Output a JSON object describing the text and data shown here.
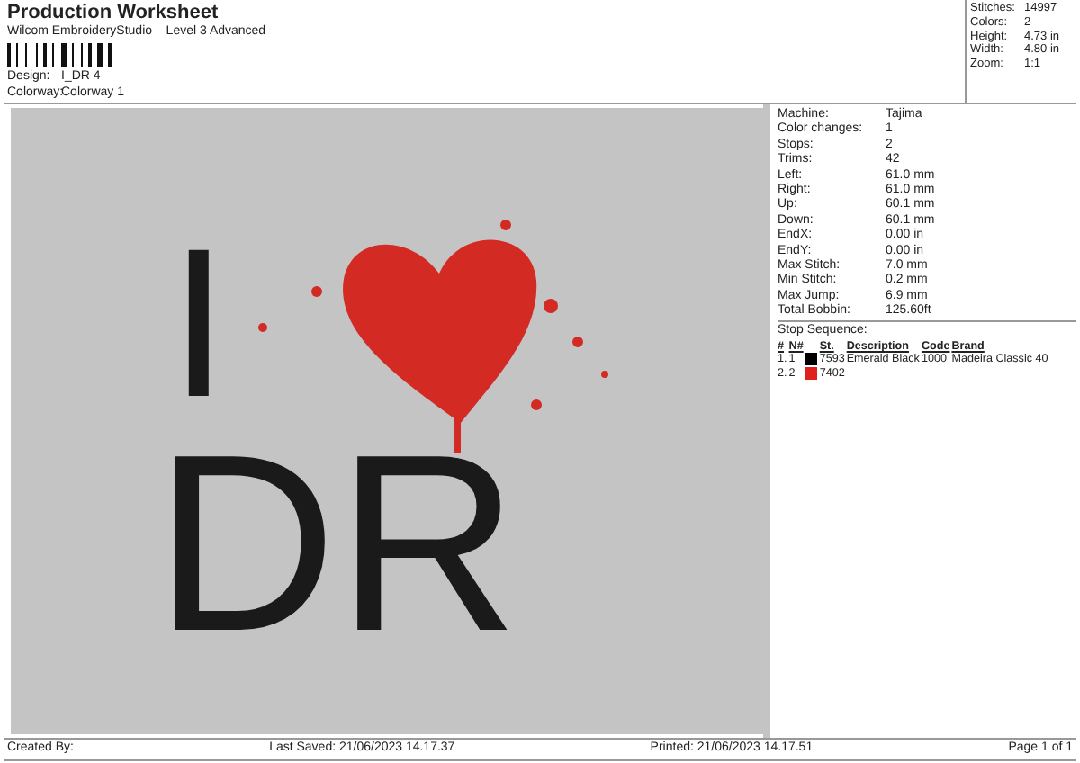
{
  "header": {
    "title": "Production Worksheet",
    "subtitle": "Wilcom EmbroideryStudio – Level 3 Advanced",
    "fields": [
      {
        "label": "Design:",
        "value": "I_DR 4"
      },
      {
        "label": "Colorway:",
        "value": "Colorway 1"
      }
    ]
  },
  "summary": [
    {
      "label": "Stitches:",
      "value": "14997"
    },
    {
      "label": "Colors:",
      "value": "2"
    },
    {
      "label": "Height:",
      "value": "4.73 in"
    },
    {
      "label": "Width:",
      "value": "4.80 in"
    },
    {
      "label": "Zoom:",
      "value": "1:1"
    }
  ],
  "preview": {
    "letters": [
      "I",
      "DR"
    ]
  },
  "details": [
    {
      "label": "Machine:",
      "value": "Tajima"
    },
    {
      "label": "Color changes:",
      "value": "1"
    },
    {
      "label": "Stops:",
      "value": "2"
    },
    {
      "label": "Trims:",
      "value": "42"
    },
    {
      "label": "Left:",
      "value": "61.0 mm"
    },
    {
      "label": "Right:",
      "value": "61.0 mm"
    },
    {
      "label": "Up:",
      "value": "60.1 mm"
    },
    {
      "label": "Down:",
      "value": "60.1 mm"
    },
    {
      "label": "EndX:",
      "value": "0.00 in"
    },
    {
      "label": "EndY:",
      "value": "0.00 in"
    },
    {
      "label": "Max Stitch:",
      "value": "7.0 mm"
    },
    {
      "label": "Min Stitch:",
      "value": "0.2 mm"
    },
    {
      "label": "Max Jump:",
      "value": "6.9 mm"
    },
    {
      "label": "Total Bobbin:",
      "value": "125.60ft"
    }
  ],
  "stop_sequence": {
    "title": "Stop Sequence:",
    "columns": [
      "#",
      "N#",
      "St.",
      "Description",
      "Code",
      "Brand"
    ],
    "rows": [
      {
        "index": "1.",
        "n": "1",
        "color": "#000000",
        "st": "7593",
        "description": "Emerald Black",
        "code": "1000",
        "brand": "Madeira Classic 40"
      },
      {
        "index": "2.",
        "n": "2",
        "color": "#e0201c",
        "st": "7402",
        "description": "",
        "code": "",
        "brand": ""
      }
    ]
  },
  "footer": {
    "created": "Created By:",
    "saved": "Last Saved: 21/06/2023 14.17.37",
    "printed": "Printed: 21/06/2023 14.17.51",
    "page": "Page 1 of 1"
  }
}
